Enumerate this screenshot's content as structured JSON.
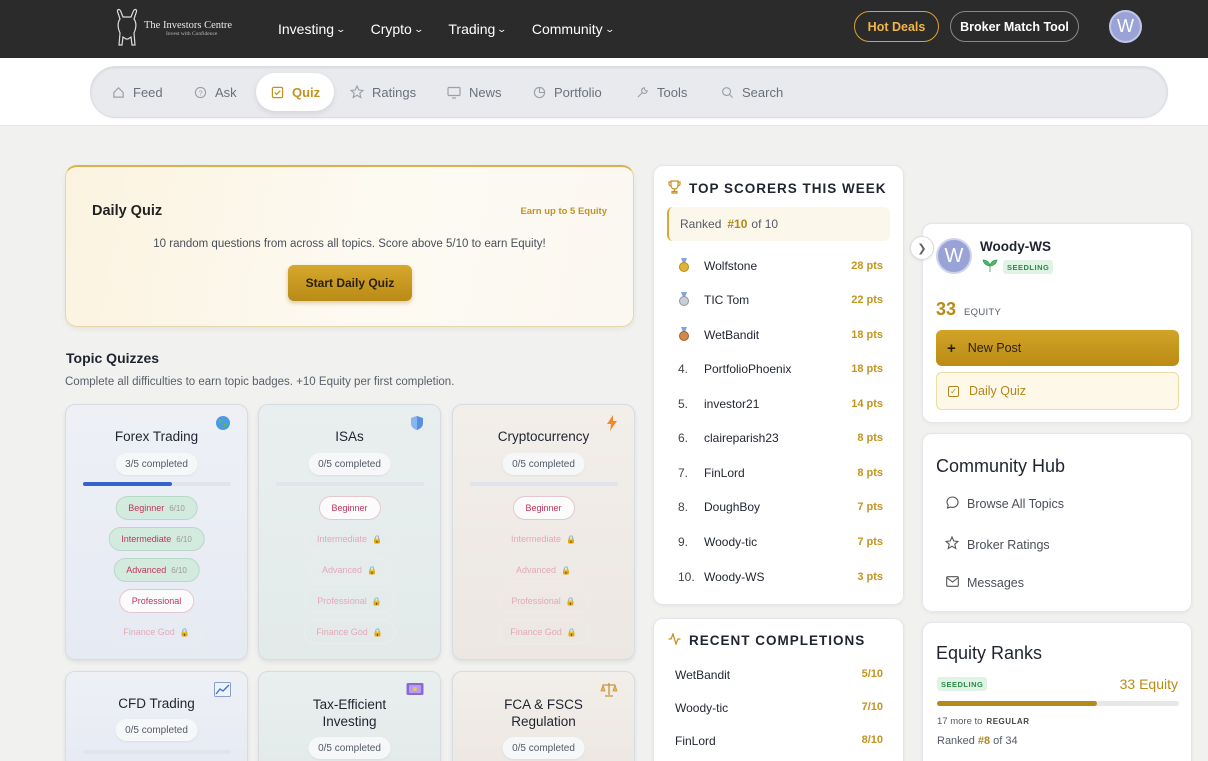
{
  "brand": {
    "name": "The Investors Centre",
    "tagline": "Invest with Confidence"
  },
  "main_nav": [
    {
      "label": "Investing"
    },
    {
      "label": "Crypto"
    },
    {
      "label": "Trading"
    },
    {
      "label": "Community"
    }
  ],
  "header_actions": {
    "hot_deals": "Hot Deals",
    "broker_match": "Broker Match Tool",
    "avatar_initial": "W"
  },
  "sub_nav": [
    {
      "label": "Feed",
      "icon": "home-icon"
    },
    {
      "label": "Ask",
      "icon": "question-icon"
    },
    {
      "label": "Quiz",
      "icon": "checkbox-icon",
      "active": true
    },
    {
      "label": "Ratings",
      "icon": "star-icon"
    },
    {
      "label": "News",
      "icon": "monitor-icon"
    },
    {
      "label": "Portfolio",
      "icon": "pie-chart-icon"
    },
    {
      "label": "Tools",
      "icon": "wrench-icon"
    },
    {
      "label": "Search",
      "icon": "search-icon"
    }
  ],
  "daily_quiz": {
    "title": "Daily Quiz",
    "earn": "Earn up to 5 Equity",
    "description": "10 random questions from across all topics. Score above 5/10 to earn Equity!",
    "button": "Start Daily Quiz"
  },
  "topic_quizzes": {
    "title": "Topic Quizzes",
    "subtitle": "Complete all difficulties to earn topic badges. +10 Equity per first completion.",
    "cards": [
      {
        "name": "Forex Trading",
        "icon": "globe-icon",
        "progress": "3/5 completed",
        "fraction": 0.6,
        "levels": [
          {
            "label": "Beginner",
            "count": "6/10",
            "state": "done"
          },
          {
            "label": "Intermediate",
            "count": "6/10",
            "state": "done"
          },
          {
            "label": "Advanced",
            "count": "6/10",
            "state": "done"
          },
          {
            "label": "Professional",
            "state": "open"
          },
          {
            "label": "Finance God",
            "state": "locked"
          }
        ]
      },
      {
        "name": "ISAs",
        "icon": "shield-icon",
        "progress": "0/5 completed",
        "fraction": 0,
        "levels": [
          {
            "label": "Beginner",
            "state": "open"
          },
          {
            "label": "Intermediate",
            "state": "locked"
          },
          {
            "label": "Advanced",
            "state": "locked"
          },
          {
            "label": "Professional",
            "state": "locked"
          },
          {
            "label": "Finance God",
            "state": "locked"
          }
        ]
      },
      {
        "name": "Cryptocurrency",
        "icon": "lightning-icon",
        "progress": "0/5 completed",
        "fraction": 0,
        "levels": [
          {
            "label": "Beginner",
            "state": "open"
          },
          {
            "label": "Intermediate",
            "state": "locked"
          },
          {
            "label": "Advanced",
            "state": "locked"
          },
          {
            "label": "Professional",
            "state": "locked"
          },
          {
            "label": "Finance God",
            "state": "locked"
          }
        ]
      },
      {
        "name": "CFD Trading",
        "icon": "chart-icon",
        "progress": "0/5 completed",
        "fraction": 0,
        "levels": []
      },
      {
        "name": "Tax-Efficient Investing",
        "icon": "money-icon",
        "progress": "0/5 completed",
        "fraction": 0,
        "levels": []
      },
      {
        "name": "FCA & FSCS Regulation",
        "icon": "scales-icon",
        "progress": "0/5 completed",
        "fraction": 0,
        "levels": []
      }
    ]
  },
  "top_scorers": {
    "title": "TOP SCORERS THIS WEEK",
    "ranked_label": "Ranked",
    "ranked_value": "#10",
    "ranked_of": "of 10",
    "rows": [
      {
        "rank": "1",
        "medal": "gold",
        "name": "Wolfstone",
        "pts": "28 pts"
      },
      {
        "rank": "2",
        "medal": "silver",
        "name": "TIC Tom",
        "pts": "22 pts"
      },
      {
        "rank": "3",
        "medal": "bronze",
        "name": "WetBandit",
        "pts": "18 pts"
      },
      {
        "rank": "4.",
        "name": "PortfolioPhoenix",
        "pts": "18 pts"
      },
      {
        "rank": "5.",
        "name": "investor21",
        "pts": "14 pts"
      },
      {
        "rank": "6.",
        "name": "claireparish23",
        "pts": "8 pts"
      },
      {
        "rank": "7.",
        "name": "FinLord",
        "pts": "8 pts"
      },
      {
        "rank": "8.",
        "name": "DoughBoy",
        "pts": "7 pts"
      },
      {
        "rank": "9.",
        "name": "Woody-tic",
        "pts": "7 pts"
      },
      {
        "rank": "10.",
        "name": "Woody-WS",
        "pts": "3 pts"
      }
    ]
  },
  "recent": {
    "title": "RECENT COMPLETIONS",
    "rows": [
      {
        "name": "WetBandit",
        "score": "5/10"
      },
      {
        "name": "Woody-tic",
        "score": "7/10"
      },
      {
        "name": "FinLord",
        "score": "8/10"
      }
    ]
  },
  "profile": {
    "initial": "W",
    "name": "Woody-WS",
    "badge": "SEEDLING",
    "equity": "33",
    "equity_label": "EQUITY",
    "new_post": "New Post",
    "daily_quiz": "Daily Quiz"
  },
  "community_hub": {
    "title": "Community Hub",
    "items": [
      {
        "label": "Browse All Topics",
        "icon": "chat-icon"
      },
      {
        "label": "Broker Ratings",
        "icon": "star-icon"
      },
      {
        "label": "Messages",
        "icon": "mail-icon"
      }
    ]
  },
  "equity_ranks": {
    "title": "Equity Ranks",
    "badge": "SEEDLING",
    "equity": "33 Equity",
    "progress_fraction": 0.66,
    "next_text": "17 more to",
    "next_rank": "REGULAR",
    "ranked_label": "Ranked",
    "ranked_value": "#8",
    "ranked_of": "of 34"
  },
  "colors": {
    "accent_gold": "#c1931f",
    "header_bg": "#2b2b2b",
    "progress_blue": "#3463c9",
    "seedling_green": "#2d8a48"
  }
}
